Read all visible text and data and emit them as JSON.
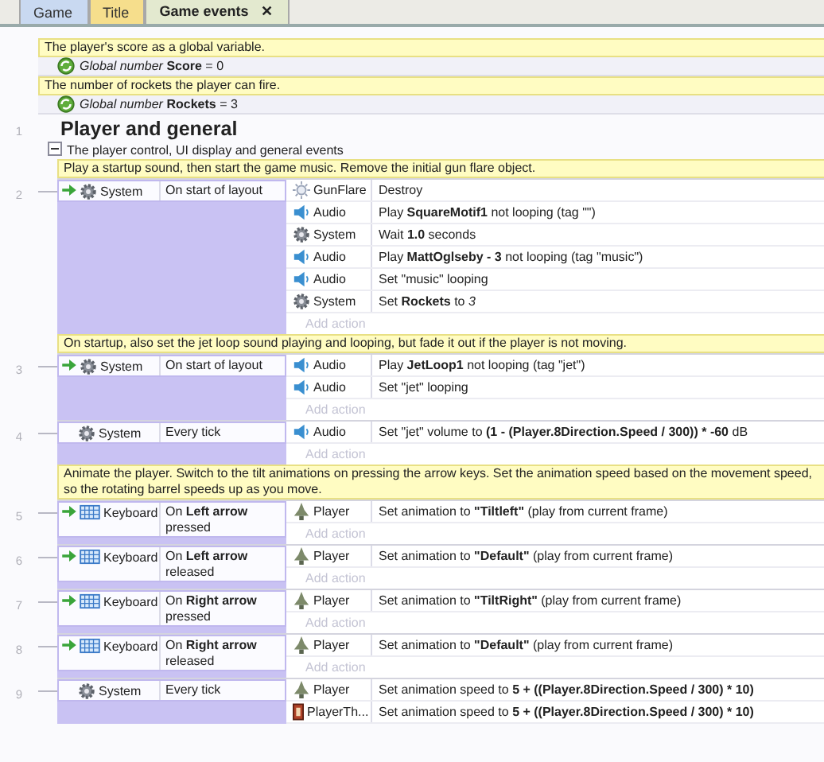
{
  "tabs": [
    {
      "label": "Game",
      "color": "#c9d9f1",
      "selected": false
    },
    {
      "label": "Title",
      "color": "#f6de8c",
      "selected": false
    },
    {
      "label": "Game events",
      "color": "#e3e9cf",
      "selected": true,
      "close": "✕"
    }
  ],
  "items": [
    {
      "kind": "comment",
      "text": "The player's score as a global variable."
    },
    {
      "kind": "variable",
      "text": "*Global number* **Score** = 0"
    },
    {
      "kind": "comment",
      "text": "The number of rockets the player can fire."
    },
    {
      "kind": "variable",
      "text": "*Global number* **Rockets** = 3"
    },
    {
      "kind": "group",
      "number": "1",
      "title": "Player and general",
      "description": "The player control, UI display and general events",
      "expanded": true,
      "children": [
        {
          "kind": "comment",
          "text": "Play a startup sound, then start the game music.  Remove the initial gun flare object."
        },
        {
          "kind": "event",
          "number": "2",
          "trigger": true,
          "conditions": [
            {
              "kind": "system",
              "object": "System",
              "text": "On start of layout"
            }
          ],
          "actions": [
            {
              "kind": "flare",
              "object": "GunFlare",
              "text": "Destroy"
            },
            {
              "kind": "audio",
              "object": "Audio",
              "text": "Play **SquareMotif1** not looping (tag \"\")"
            },
            {
              "kind": "system",
              "object": "System",
              "text": "Wait **1.0** seconds"
            },
            {
              "kind": "audio",
              "object": "Audio",
              "text": "Play **MattOglseby - 3** not looping (tag \"music\")"
            },
            {
              "kind": "audio",
              "object": "Audio",
              "text": "Set \"music\" looping"
            },
            {
              "kind": "system",
              "object": "System",
              "text": "Set **Rockets** to *3*"
            }
          ],
          "add_action": "Add action"
        },
        {
          "kind": "comment",
          "text": "On startup, also set the jet loop sound playing and looping, but fade it out if the player is not moving."
        },
        {
          "kind": "event",
          "number": "3",
          "trigger": true,
          "conditions": [
            {
              "kind": "system",
              "object": "System",
              "text": "On start of layout"
            }
          ],
          "actions": [
            {
              "kind": "audio",
              "object": "Audio",
              "text": "Play **JetLoop1** not looping (tag \"jet\")"
            },
            {
              "kind": "audio",
              "object": "Audio",
              "text": "Set \"jet\" looping"
            }
          ],
          "add_action": "Add action"
        },
        {
          "kind": "event",
          "number": "4",
          "trigger": false,
          "conditions": [
            {
              "kind": "system",
              "object": "System",
              "text": "Every tick"
            }
          ],
          "actions": [
            {
              "kind": "audio",
              "object": "Audio",
              "text": "Set \"jet\" volume to **(1 - (Player.8Direction.Speed / 300)) * -60** dB"
            }
          ],
          "add_action": "Add action"
        },
        {
          "kind": "comment",
          "text": "Animate the player.  Switch to the tilt animations on pressing the arrow keys.  Set the animation speed based on the movement speed, so the rotating barrel speeds up as you move."
        },
        {
          "kind": "event",
          "number": "5",
          "trigger": true,
          "conditions": [
            {
              "kind": "keyboard",
              "object": "Keyboard",
              "text": "On **Left arrow** pressed"
            }
          ],
          "actions": [
            {
              "kind": "sprite",
              "object": "Player",
              "text": "Set animation to **\"Tiltleft\"** (play from current frame)"
            }
          ],
          "add_action": "Add action"
        },
        {
          "kind": "event",
          "number": "6",
          "trigger": true,
          "conditions": [
            {
              "kind": "keyboard",
              "object": "Keyboard",
              "text": "On **Left arrow** released"
            }
          ],
          "actions": [
            {
              "kind": "sprite",
              "object": "Player",
              "text": "Set animation to **\"Default\"** (play from current frame)"
            }
          ],
          "add_action": "Add action"
        },
        {
          "kind": "event",
          "number": "7",
          "trigger": true,
          "conditions": [
            {
              "kind": "keyboard",
              "object": "Keyboard",
              "text": "On **Right arrow** pressed"
            }
          ],
          "actions": [
            {
              "kind": "sprite",
              "object": "Player",
              "text": "Set animation to **\"TiltRight\"** (play from current frame)"
            }
          ],
          "add_action": "Add action"
        },
        {
          "kind": "event",
          "number": "8",
          "trigger": true,
          "conditions": [
            {
              "kind": "keyboard",
              "object": "Keyboard",
              "text": "On **Right arrow** released"
            }
          ],
          "actions": [
            {
              "kind": "sprite",
              "object": "Player",
              "text": "Set animation to **\"Default\"** (play from current frame)"
            }
          ],
          "add_action": "Add action"
        },
        {
          "kind": "event",
          "number": "9",
          "trigger": false,
          "conditions": [
            {
              "kind": "system",
              "object": "System",
              "text": "Every tick"
            }
          ],
          "actions": [
            {
              "kind": "sprite",
              "object": "Player",
              "text": "Set animation speed to **5 + ((Player.8Direction.Speed / 300) * 10)**"
            },
            {
              "kind": "tile",
              "object": "PlayerTh...",
              "text": "Set animation speed to **5 + ((Player.8Direction.Speed / 300) * 10)**"
            }
          ]
        }
      ]
    }
  ]
}
